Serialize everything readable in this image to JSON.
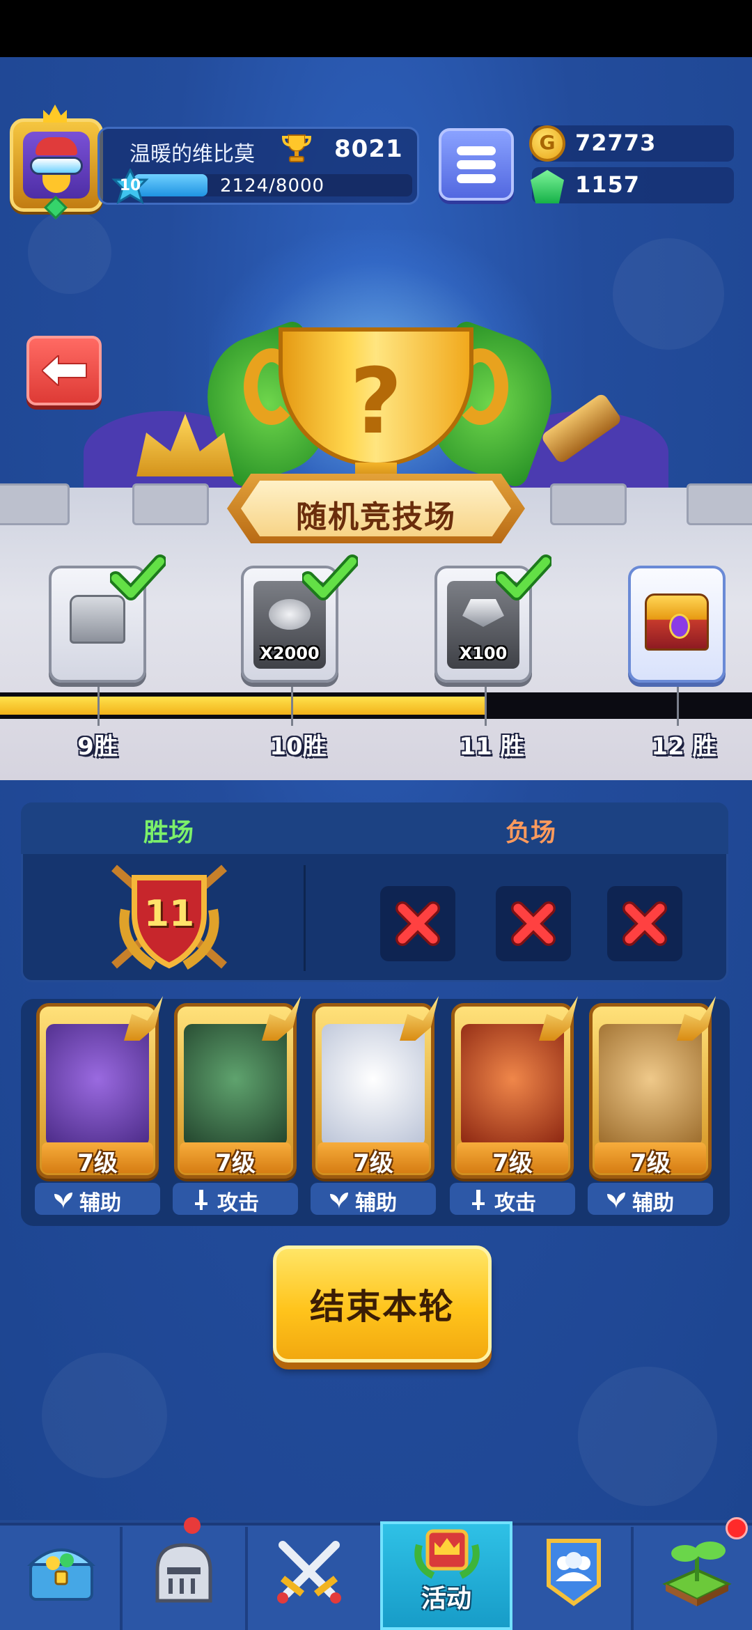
{
  "player": {
    "name": "温暖的维比莫",
    "trophies": "8021",
    "level": "10",
    "xp_text": "2124/8000",
    "xp_progress": 0.2655
  },
  "currency": {
    "gold": "72773",
    "gems": "1157"
  },
  "arena": {
    "title": "随机竞技场"
  },
  "rewards": [
    {
      "win_label": "9胜",
      "claimed": true,
      "type": "silver-chest",
      "qty": ""
    },
    {
      "win_label": "10胜",
      "claimed": true,
      "type": "coins",
      "qty": "X2000"
    },
    {
      "win_label": "11 胜",
      "claimed": true,
      "type": "gems",
      "qty": "X100"
    },
    {
      "win_label": "12 胜",
      "claimed": false,
      "type": "gold-chest",
      "qty": ""
    }
  ],
  "win_progress": 0.644,
  "stats": {
    "wins_label": "胜场",
    "losses_label": "负场",
    "wins": "11",
    "losses_used": 3
  },
  "team": [
    {
      "level": "7级",
      "role": "辅助",
      "role_icon": "support-icon",
      "color": "#6d3fb4"
    },
    {
      "level": "7级",
      "role": "攻击",
      "role_icon": "sword-icon",
      "color": "#3b6b4a"
    },
    {
      "level": "7级",
      "role": "辅助",
      "role_icon": "support-icon",
      "color": "#e8ecf4"
    },
    {
      "level": "7级",
      "role": "攻击",
      "role_icon": "sword-icon",
      "color": "#c2461e"
    },
    {
      "level": "7级",
      "role": "辅助",
      "role_icon": "support-icon",
      "color": "#c89a4a"
    }
  ],
  "end_button": {
    "label": "结束本轮"
  },
  "nav": {
    "active": "activities",
    "items": [
      {
        "id": "shop",
        "icon": "treasure-chest-icon"
      },
      {
        "id": "heroes",
        "icon": "knight-helmet-icon"
      },
      {
        "id": "battle",
        "icon": "crossed-swords-icon"
      },
      {
        "id": "activities",
        "icon": "crown-icon",
        "label": "活动"
      },
      {
        "id": "guild",
        "icon": "team-banner-icon"
      },
      {
        "id": "farm",
        "icon": "sprout-icon"
      }
    ]
  },
  "colors": {
    "accent_gold": "#ffc41c",
    "background": "#234a93",
    "win_green": "#7cf06a",
    "loss_orange": "#ff9a5c"
  }
}
